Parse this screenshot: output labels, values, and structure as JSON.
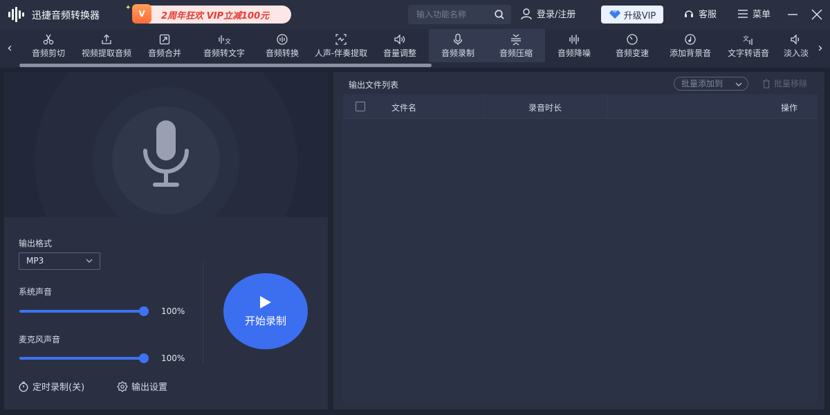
{
  "app": {
    "title": "迅捷音频转换器"
  },
  "promo": {
    "badge": "V",
    "text": "2周年狂欢 VIP立减100元"
  },
  "search": {
    "placeholder": "输入功能名称",
    "value": ""
  },
  "header": {
    "login_label": "登录/注册",
    "vip_label": "升级VIP",
    "service_label": "客服",
    "menu_label": "菜单"
  },
  "toolbar": {
    "items": [
      {
        "label": "音频剪切",
        "icon": "scissors-icon"
      },
      {
        "label": "视频提取音频",
        "icon": "upload-icon"
      },
      {
        "label": "音频合并",
        "icon": "merge-icon"
      },
      {
        "label": "音频转文字",
        "icon": "audio-to-text-icon"
      },
      {
        "label": "音频转换",
        "icon": "convert-icon"
      },
      {
        "label": "人声-伴奏提取",
        "icon": "extract-icon"
      },
      {
        "label": "音量调整",
        "icon": "volume-icon"
      },
      {
        "label": "音频录制",
        "icon": "microphone-icon",
        "active": true
      },
      {
        "label": "音频压缩",
        "icon": "compress-icon",
        "active": true
      },
      {
        "label": "音频降噪",
        "icon": "waveform-icon"
      },
      {
        "label": "音频变速",
        "icon": "speed-icon"
      },
      {
        "label": "添加背景音",
        "icon": "music-disc-icon"
      },
      {
        "label": "文字转语音",
        "icon": "text-to-speech-icon"
      },
      {
        "label": "淡入淡",
        "icon": "fade-icon"
      }
    ]
  },
  "recorder": {
    "format_label": "输出格式",
    "format_value": "MP3",
    "system_sound_label": "系统声音",
    "system_sound_value": 1.0,
    "system_sound_text": "100%",
    "mic_sound_label": "麦克风声音",
    "mic_sound_value": 1.0,
    "mic_sound_text": "100%",
    "start_label": "开始录制",
    "timer_label": "定时录制(关)",
    "settings_label": "输出设置"
  },
  "output_list": {
    "title": "输出文件列表",
    "batch_add_label": "批量添加到",
    "batch_remove_label": "批量移除",
    "columns": [
      "文件名",
      "录音时长",
      "操作"
    ],
    "rows": []
  },
  "colors": {
    "accent": "#3c6ef0",
    "promo_text": "#e53e36",
    "background": "#1f2433"
  }
}
